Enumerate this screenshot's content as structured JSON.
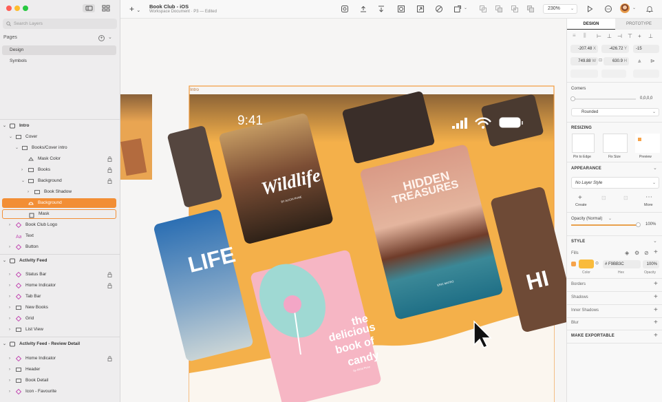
{
  "layers_panel": {
    "search_placeholder": "Search Layers",
    "pages_label": "Pages",
    "pages": [
      "Design",
      "Symbols"
    ],
    "layers": [
      {
        "label": "Intro",
        "icon": "artboard-icon"
      },
      {
        "label": "Cover",
        "icon": "group-icon"
      },
      {
        "label": "Books/Cover intro",
        "icon": "group-icon"
      },
      {
        "label": "Mask Color",
        "icon": "mask-icon"
      },
      {
        "label": "Books",
        "icon": "group-icon"
      },
      {
        "label": "Background",
        "icon": "group-icon"
      },
      {
        "label": "Book Shadow",
        "icon": "group-icon"
      },
      {
        "label": "Background",
        "icon": "shape-icon"
      },
      {
        "label": "Mask",
        "icon": "rectangle-icon"
      },
      {
        "label": "Book Club Logo",
        "icon": "symbol-icon"
      },
      {
        "label": "Text",
        "icon": "text-icon"
      },
      {
        "label": "Button",
        "icon": "symbol-icon"
      },
      {
        "label": "Activity Feed",
        "icon": "artboard-icon"
      },
      {
        "label": "Status Bar",
        "icon": "symbol-icon"
      },
      {
        "label": "Home Indicator",
        "icon": "symbol-icon"
      },
      {
        "label": "Tab Bar",
        "icon": "symbol-icon"
      },
      {
        "label": "New Books",
        "icon": "group-icon"
      },
      {
        "label": "Grid",
        "icon": "symbol-icon"
      },
      {
        "label": "List View",
        "icon": "group-icon"
      },
      {
        "label": "Activity Feed - Review Detail",
        "icon": "artboard-icon"
      },
      {
        "label": "Home Indicator",
        "icon": "symbol-icon"
      },
      {
        "label": "Header",
        "icon": "group-icon"
      },
      {
        "label": "Book Detail",
        "icon": "group-icon"
      },
      {
        "label": "Icon - Favourite",
        "icon": "symbol-icon"
      }
    ]
  },
  "toolbar": {
    "doc_title": "Book Club - iOS",
    "doc_subtitle": "Workspace Document · P3 — Edited",
    "zoom": "230%"
  },
  "canvas": {
    "artboard_label": "Intro",
    "status_time": "9:41",
    "book_wildlife_title": "Wildlife",
    "book_wildlife_author": "BY ALICIA PUNE",
    "book_hidden_title_1": "HIDDEN",
    "book_hidden_title_2": "TREASURES",
    "book_hidden_author": "ERIC MATEO",
    "book_candy_line1": "the",
    "book_candy_line2": "delicious",
    "book_candy_line3": "book of",
    "book_candy_line4": "candy",
    "book_candy_author": "by Alicia Pune",
    "book_life_text": "LIFE",
    "book_hi_text": "HI",
    "background_color": "#F9BB3C"
  },
  "inspector": {
    "tab_design": "DESIGN",
    "tab_prototype": "PROTOTYPE",
    "x_value": "-207.48",
    "x_label": "X",
    "y_value": "-426.72",
    "y_label": "Y",
    "rotation_value": "-15",
    "w_value": "749.88",
    "w_label": "W",
    "h_value": "630.9",
    "h_label": "H",
    "corners_label": "Corners",
    "corners_value": "0,0,0,0",
    "corner_style": "Rounded",
    "resizing_label": "RESIZING",
    "resize_pin": "Pin to Edge",
    "resize_fix": "Fix Size",
    "resize_preview": "Preview",
    "appearance_label": "APPEARANCE",
    "layer_style": "No Layer Style",
    "create_label": "Create",
    "more_label": "More",
    "opacity_label": "Opacity (Normal)",
    "opacity_value": "100%",
    "style_label": "STYLE",
    "fills_label": "Fills",
    "fill_hex": "F9BB3C",
    "fill_opacity": "100%",
    "fill_color": "#F9BB3C",
    "color_caption": "Color",
    "hex_caption": "Hex",
    "opacity_caption": "Opacity",
    "borders_label": "Borders",
    "shadows_label": "Shadows",
    "inner_shadows_label": "Inner Shadows",
    "blur_label": "Blur",
    "exportable_label": "MAKE EXPORTABLE"
  }
}
